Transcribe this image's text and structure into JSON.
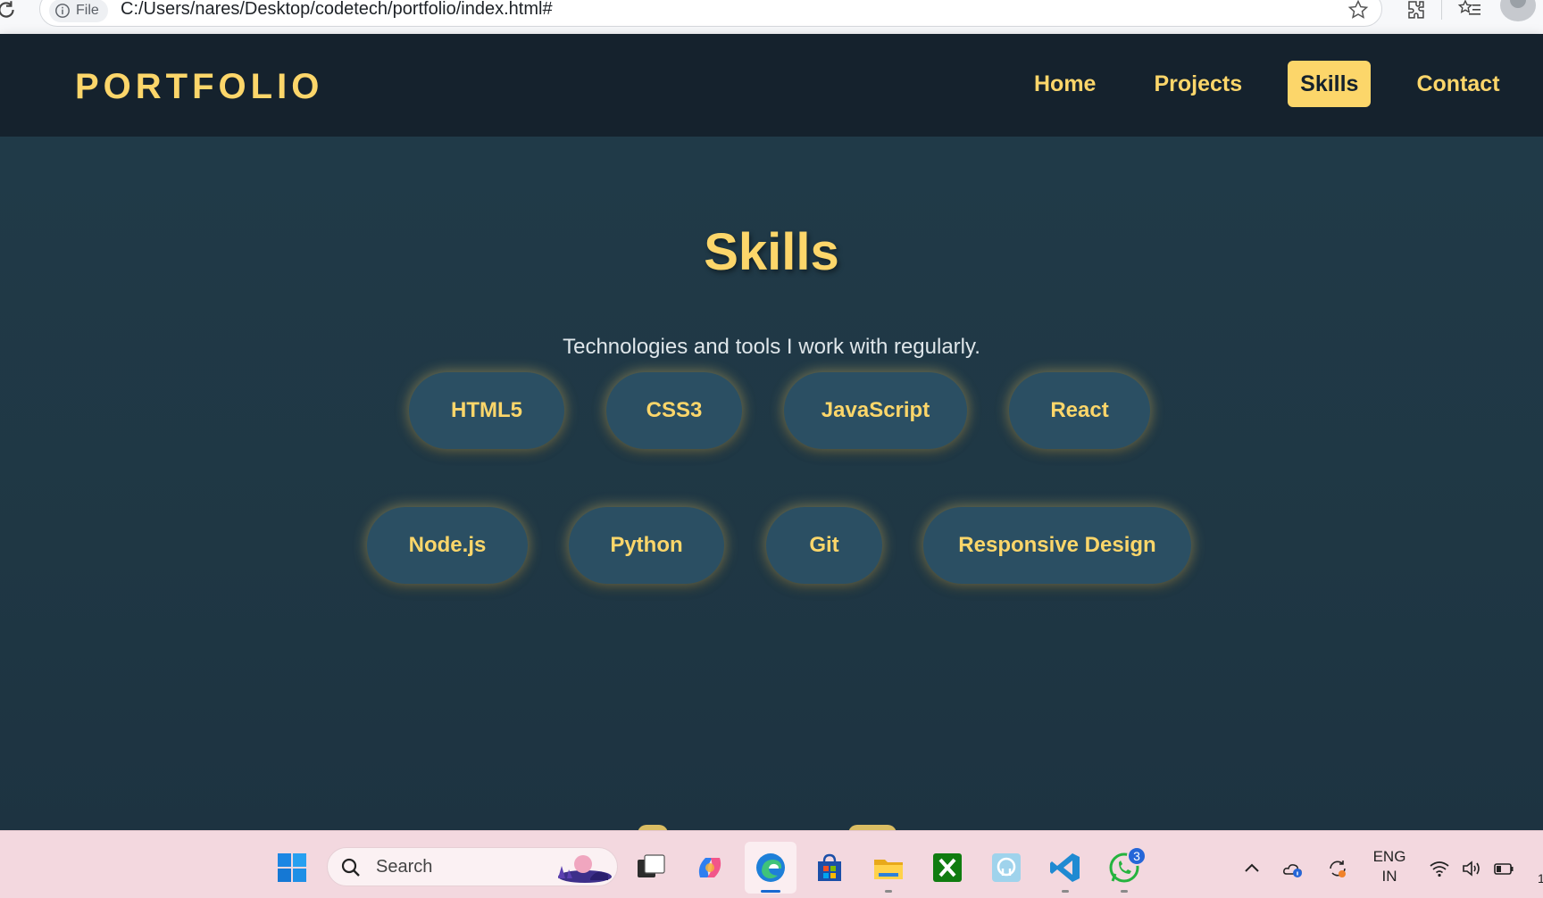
{
  "browser": {
    "file_label": "File",
    "url": "C:/Users/nares/Desktop/codetech/portfolio/index.html#"
  },
  "site": {
    "logo": "PORTFOLIO",
    "nav": [
      {
        "label": "Home",
        "active": false
      },
      {
        "label": "Projects",
        "active": false
      },
      {
        "label": "Skills",
        "active": true
      },
      {
        "label": "Contact",
        "active": false
      }
    ]
  },
  "skills_section": {
    "title": "Skills",
    "subtitle": "Technologies and tools I work with regularly.",
    "skills": [
      "HTML5",
      "CSS3",
      "JavaScript",
      "React",
      "Node.js",
      "Python",
      "Git",
      "Responsive Design"
    ]
  },
  "taskbar": {
    "search_label": "Search",
    "whatsapp_badge": "3",
    "language_line1": "ENG",
    "language_line2": "IN",
    "clock_partial": "1"
  },
  "colors": {
    "accent": "#fcd66a",
    "header_bg": "#15222d",
    "section_bg": "#1f3744",
    "pill_bg": "#2b4f63"
  }
}
